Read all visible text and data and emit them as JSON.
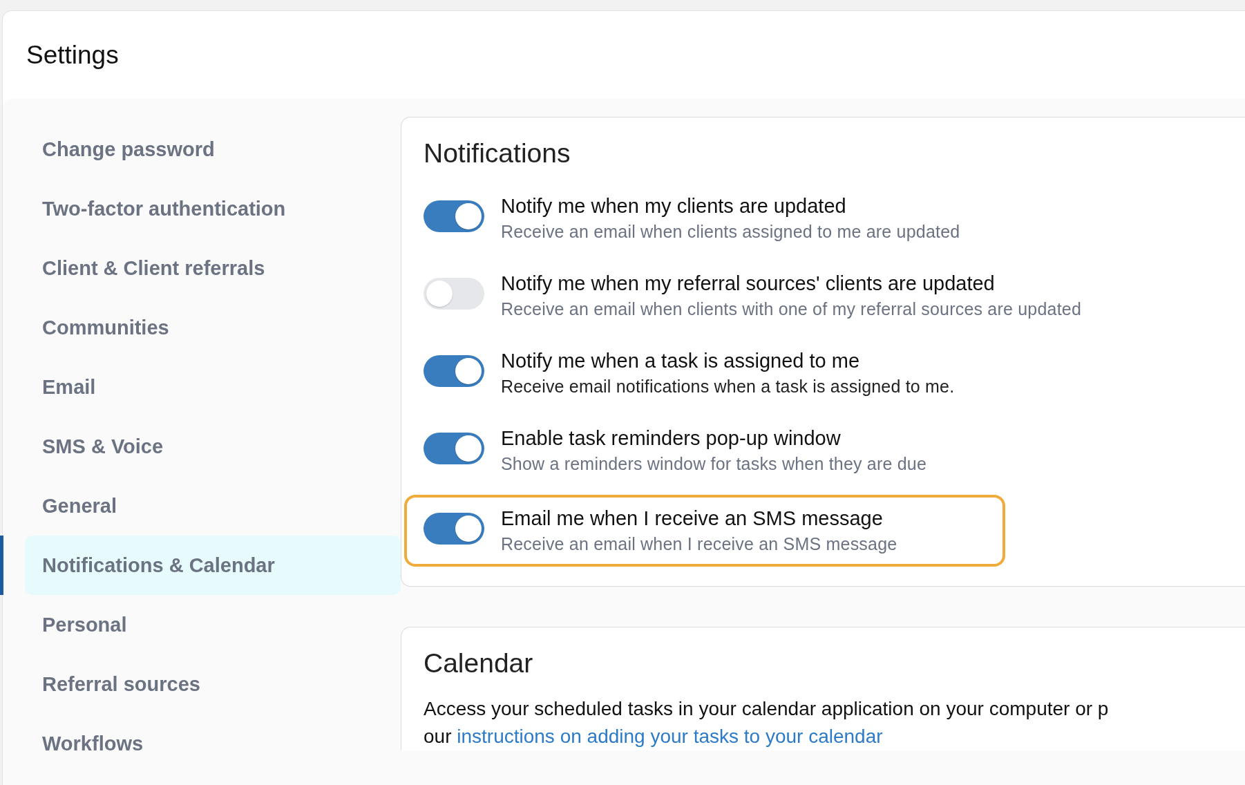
{
  "page": {
    "title": "Settings"
  },
  "sidebar": {
    "items": [
      {
        "label": "Change password",
        "selected": false
      },
      {
        "label": "Two-factor authentication",
        "selected": false
      },
      {
        "label": "Client & Client referrals",
        "selected": false
      },
      {
        "label": "Communities",
        "selected": false
      },
      {
        "label": "Email",
        "selected": false
      },
      {
        "label": "SMS & Voice",
        "selected": false
      },
      {
        "label": "General",
        "selected": false
      },
      {
        "label": "Notifications & Calendar",
        "selected": true
      },
      {
        "label": "Personal",
        "selected": false
      },
      {
        "label": "Referral sources",
        "selected": false
      },
      {
        "label": "Workflows",
        "selected": false
      }
    ]
  },
  "notifications": {
    "heading": "Notifications",
    "settings": [
      {
        "label": "Notify me when my clients are updated",
        "description": "Receive an email when clients assigned to me are updated",
        "on": true,
        "highlighted": false,
        "emphasis": false
      },
      {
        "label": "Notify me when my referral sources' clients are updated",
        "description": "Receive an email when clients with one of my referral sources are updated",
        "on": false,
        "highlighted": false,
        "emphasis": false
      },
      {
        "label": "Notify me when a task is assigned to me",
        "description": "Receive email notifications when a task is assigned to me.",
        "on": true,
        "highlighted": false,
        "emphasis": true
      },
      {
        "label": "Enable task reminders pop-up window",
        "description": "Show a reminders window for tasks when they are due",
        "on": true,
        "highlighted": false,
        "emphasis": false
      },
      {
        "label": "Email me when I receive an SMS message",
        "description": "Receive an email when I receive an SMS message",
        "on": true,
        "highlighted": true,
        "emphasis": false
      }
    ]
  },
  "calendar": {
    "heading": "Calendar",
    "text": "Access your scheduled tasks in your calendar application on your computer or p",
    "text_continued": "our",
    "link": "instructions on adding your tasks to your calendar"
  }
}
